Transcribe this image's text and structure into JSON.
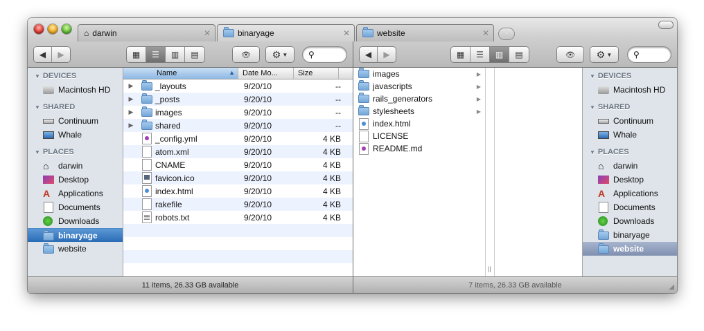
{
  "tabs": [
    {
      "label": "darwin",
      "icon": "home-icon"
    },
    {
      "label": "binaryage",
      "icon": "folder-icon"
    },
    {
      "label": "website",
      "icon": "folder-icon"
    }
  ],
  "tab_close_glyph": "✕",
  "tab_add_glyph": "+",
  "left_pane": {
    "status": "11 items, 26.33 GB available",
    "list_headers": {
      "name": "Name",
      "date": "Date Mo...",
      "size": "Size"
    },
    "files": [
      {
        "name": "_layouts",
        "date": "9/20/10",
        "size": "--",
        "kind": "folder"
      },
      {
        "name": "_posts",
        "date": "9/20/10",
        "size": "--",
        "kind": "folder"
      },
      {
        "name": "images",
        "date": "9/20/10",
        "size": "--",
        "kind": "folder"
      },
      {
        "name": "shared",
        "date": "9/20/10",
        "size": "--",
        "kind": "folder"
      },
      {
        "name": "_config.yml",
        "date": "9/20/10",
        "size": "4 KB",
        "kind": "code"
      },
      {
        "name": "atom.xml",
        "date": "9/20/10",
        "size": "4 KB",
        "kind": "file"
      },
      {
        "name": "CNAME",
        "date": "9/20/10",
        "size": "4 KB",
        "kind": "file"
      },
      {
        "name": "favicon.ico",
        "date": "9/20/10",
        "size": "4 KB",
        "kind": "image"
      },
      {
        "name": "index.html",
        "date": "9/20/10",
        "size": "4 KB",
        "kind": "web"
      },
      {
        "name": "rakefile",
        "date": "9/20/10",
        "size": "4 KB",
        "kind": "file"
      },
      {
        "name": "robots.txt",
        "date": "9/20/10",
        "size": "4 KB",
        "kind": "text"
      }
    ]
  },
  "right_pane": {
    "status": "7 items, 26.33 GB available",
    "column_items": [
      {
        "name": "images",
        "kind": "folder"
      },
      {
        "name": "javascripts",
        "kind": "folder"
      },
      {
        "name": "rails_generators",
        "kind": "folder"
      },
      {
        "name": "stylesheets",
        "kind": "folder"
      },
      {
        "name": "index.html",
        "kind": "web"
      },
      {
        "name": "LICENSE",
        "kind": "file"
      },
      {
        "name": "README.md",
        "kind": "code"
      }
    ]
  },
  "sidebar": {
    "devices_header": "DEVICES",
    "shared_header": "SHARED",
    "places_header": "PLACES",
    "devices": [
      {
        "label": "Macintosh HD",
        "icon": "hard-drive-icon"
      }
    ],
    "shared": [
      {
        "label": "Continuum",
        "icon": "network-drive-icon"
      },
      {
        "label": "Whale",
        "icon": "monitor-icon"
      }
    ],
    "places": [
      {
        "label": "darwin",
        "icon": "home-icon"
      },
      {
        "label": "Desktop",
        "icon": "desktop-icon"
      },
      {
        "label": "Applications",
        "icon": "applications-icon"
      },
      {
        "label": "Documents",
        "icon": "documents-icon"
      },
      {
        "label": "Downloads",
        "icon": "downloads-icon"
      },
      {
        "label": "binaryage",
        "icon": "folder-icon"
      },
      {
        "label": "website",
        "icon": "folder-icon"
      }
    ]
  },
  "glyphs": {
    "back": "◀",
    "forward": "▶",
    "eye": "👁",
    "gear": "⚙",
    "search": "⚲",
    "sort_arrow": "▲",
    "disclosure": "▶",
    "section_triangle": "▼",
    "grip": "||",
    "resize": "◢"
  },
  "colors": {
    "selection_active": "#2a6cb6",
    "selection_inactive": "#8190b0",
    "sidebar_bg": "#dee4ea",
    "stripe": "#edf3fe"
  }
}
